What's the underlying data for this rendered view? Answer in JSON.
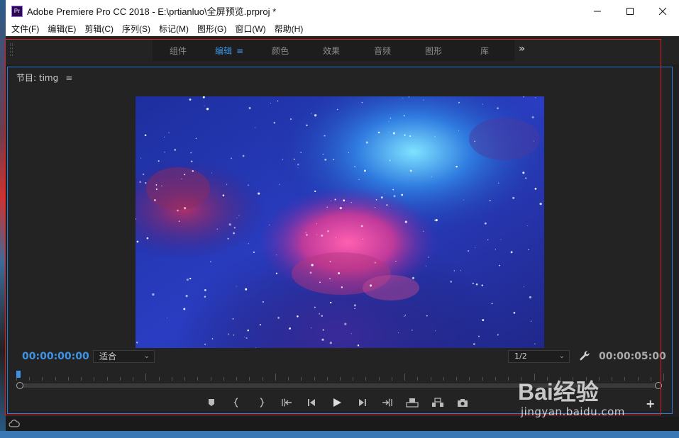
{
  "window": {
    "app_icon_text": "Pr",
    "title": "Adobe Premiere Pro CC 2018 - E:\\prtianluo\\全屏预览.prproj *",
    "minimize_icon": "minimize-icon",
    "maximize_icon": "maximize-icon",
    "close_icon": "close-icon"
  },
  "menu": {
    "items": [
      {
        "label": "文件(F)"
      },
      {
        "label": "编辑(E)"
      },
      {
        "label": "剪辑(C)"
      },
      {
        "label": "序列(S)"
      },
      {
        "label": "标记(M)"
      },
      {
        "label": "图形(G)"
      },
      {
        "label": "窗口(W)"
      },
      {
        "label": "帮助(H)"
      }
    ]
  },
  "workspace": {
    "tabs": [
      {
        "label": "组件",
        "active": false
      },
      {
        "label": "编辑",
        "active": true
      },
      {
        "label": "颜色",
        "active": false
      },
      {
        "label": "效果",
        "active": false
      },
      {
        "label": "音频",
        "active": false
      },
      {
        "label": "图形",
        "active": false
      },
      {
        "label": "库",
        "active": false
      }
    ],
    "more_label": "»",
    "active_menu_icon": "≡"
  },
  "program": {
    "title": "节目: timg",
    "menu_icon": "≡",
    "current_time": "00:00:00:00",
    "duration": "00:00:05:00",
    "zoom_fit": "适合",
    "resolution": "1/2",
    "playhead_fraction": 0.0,
    "transport": [
      {
        "name": "add-marker-icon"
      },
      {
        "name": "mark-in-icon"
      },
      {
        "name": "mark-out-icon"
      },
      {
        "name": "go-to-in-icon"
      },
      {
        "name": "step-back-icon"
      },
      {
        "name": "play-icon"
      },
      {
        "name": "step-forward-icon"
      },
      {
        "name": "go-to-out-icon"
      },
      {
        "name": "lift-icon"
      },
      {
        "name": "extract-icon"
      },
      {
        "name": "export-frame-icon"
      }
    ],
    "plus_label": "+"
  },
  "watermark": {
    "logo": "Bai经验",
    "url": "jingyan.baidu.com"
  },
  "colors": {
    "accent": "#3d94e6",
    "highlight": "#e02020"
  }
}
